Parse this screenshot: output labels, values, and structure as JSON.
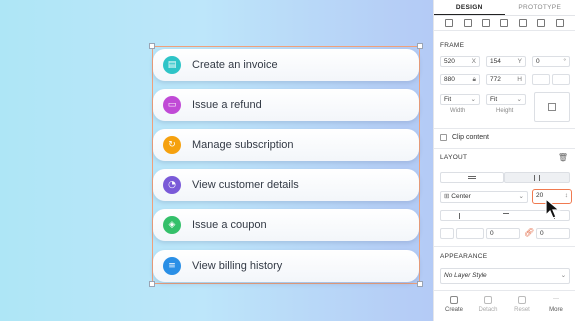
{
  "cards": [
    {
      "label": "Create an invoice",
      "color": "#2ec4c7",
      "icon": "invoice-icon",
      "glyph": "▤"
    },
    {
      "label": "Issue a refund",
      "color": "#c04ad6",
      "icon": "refund-icon",
      "glyph": "▭"
    },
    {
      "label": "Manage subscription",
      "color": "#f5a10f",
      "icon": "subscription-icon",
      "glyph": "↻"
    },
    {
      "label": "View customer details",
      "color": "#7a5ad8",
      "icon": "customer-icon",
      "glyph": "◔"
    },
    {
      "label": "Issue a coupon",
      "color": "#34c06a",
      "icon": "coupon-icon",
      "glyph": "◈"
    },
    {
      "label": "View billing history",
      "color": "#2a8fe6",
      "icon": "billing-history-icon",
      "glyph": "≡"
    }
  ],
  "inspector": {
    "tabs": {
      "design": "DESIGN",
      "prototype": "PROTOTYPE"
    },
    "frame": {
      "title": "FRAME",
      "x": "520",
      "x_label": "X",
      "y": "154",
      "y_label": "Y",
      "rotation": "0",
      "w": "880",
      "h": "772",
      "h_label": "H",
      "width_mode": "Fit",
      "height_mode": "Fit",
      "width_label": "Width",
      "height_label": "Height"
    },
    "clip_content": "Clip content",
    "layout": {
      "title": "LAYOUT",
      "alignment": "Center",
      "gap": "20",
      "padding_left": "0",
      "padding_right": "0"
    },
    "appearance": {
      "title": "APPEARANCE",
      "layer_style": "No Layer Style"
    },
    "bottom_bar": [
      "Create",
      "Detach",
      "Reset",
      "More"
    ]
  }
}
